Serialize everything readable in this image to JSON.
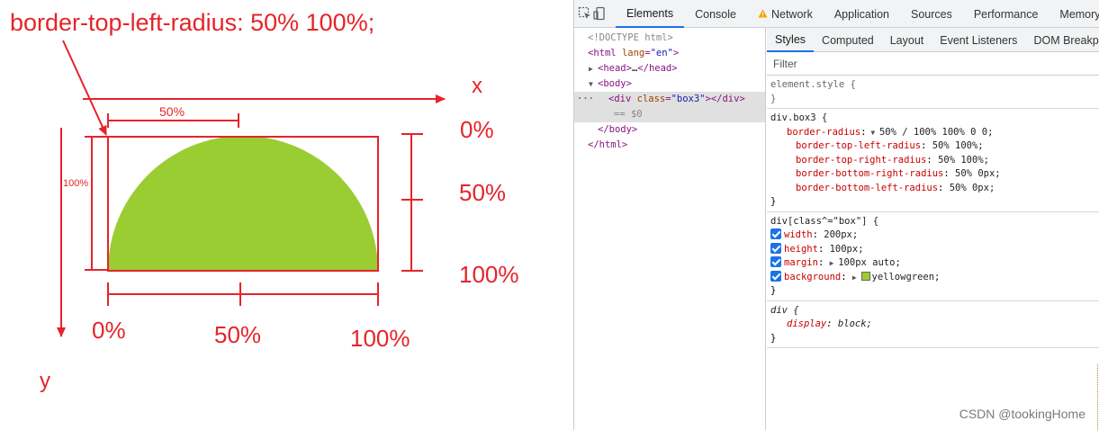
{
  "diagram": {
    "title": "border-top-left-radius: 50% 100%;",
    "x_axis": "x",
    "y_axis": "y",
    "width_mark": "50%",
    "height_mark": "100%",
    "right_labels": [
      "0%",
      "50%",
      "100%"
    ],
    "bottom_labels": [
      "0%",
      "50%",
      "100%"
    ],
    "shape_color": "#9acd32",
    "annotation_color": "#e5242a"
  },
  "devtools": {
    "tabs": [
      "Elements",
      "Console",
      "Network",
      "Application",
      "Sources",
      "Performance",
      "Memory"
    ],
    "active_tab": "Elements",
    "icons": [
      "inspect-icon",
      "device-toggle-icon",
      "warning-icon"
    ],
    "dom": {
      "doctype": "<!DOCTYPE html>",
      "html_open_tag": "html",
      "html_attr_name": "lang",
      "html_attr_value": "\"en\"",
      "head_tag": "head",
      "head_ellipsis": "…",
      "body_tag": "body",
      "div_tag": "div",
      "div_attr_name": "class",
      "div_attr_value": "\"box3\"",
      "selected_suffix": "== $0",
      "body_close": "</body>",
      "html_close": "</html>"
    },
    "styles_tabs": [
      "Styles",
      "Computed",
      "Layout",
      "Event Listeners",
      "DOM Breakpoints"
    ],
    "active_styles_tab": "Styles",
    "filter_placeholder": "Filter",
    "rules": {
      "element_style": {
        "selector": "element.style {",
        "close": "}"
      },
      "box3": {
        "selector": "div.box3 {",
        "shorthand_name": "border-radius",
        "shorthand_value": "50% / 100% 100% 0 0;",
        "longhands": [
          {
            "name": "border-top-left-radius",
            "value": "50% 100%;"
          },
          {
            "name": "border-top-right-radius",
            "value": "50% 100%;"
          },
          {
            "name": "border-bottom-right-radius",
            "value": "50% 0px;"
          },
          {
            "name": "border-bottom-left-radius",
            "value": "50% 0px;"
          }
        ],
        "close": "}"
      },
      "box_prefix": {
        "selector": "div[class^=\"box\"] {",
        "decls": [
          {
            "name": "width",
            "value": "200px;"
          },
          {
            "name": "height",
            "value": "100px;"
          },
          {
            "name": "margin",
            "value": "100px auto;"
          },
          {
            "name": "background",
            "value": "yellowgreen;"
          }
        ],
        "close": "}"
      },
      "div_ua": {
        "selector": "div {",
        "decl_name": "display",
        "decl_value": "block;",
        "close": "}"
      }
    },
    "swatch_color": "#9acd32",
    "watermark": "CSDN @tookingHome"
  }
}
